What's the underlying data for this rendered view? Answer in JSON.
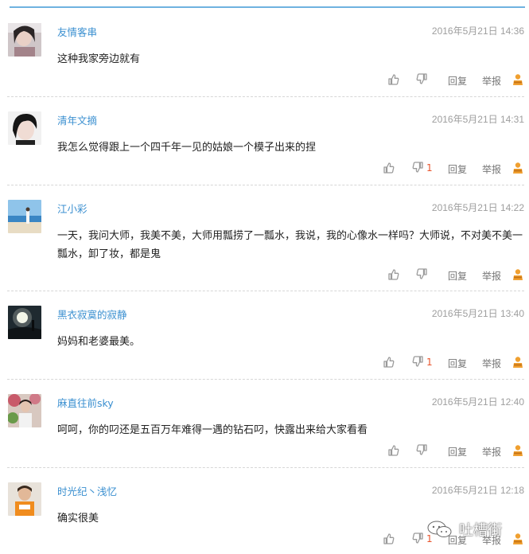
{
  "comments": [
    {
      "username": "友情客串",
      "timestamp": "2016年5月21日 14:36",
      "text": "这种我家旁边就有",
      "reply": "回复",
      "report": "举报",
      "dislikes": ""
    },
    {
      "username": "清年文摘",
      "timestamp": "2016年5月21日 14:31",
      "text": "我怎么觉得跟上一个四千年一见的姑娘一个模子出来的捏",
      "reply": "回复",
      "report": "举报",
      "dislikes": "1"
    },
    {
      "username": "江小彩",
      "timestamp": "2016年5月21日 14:22",
      "text": "一天，我问大师，我美不美，大师用瓢捞了一瓢水，我说，我的心像水一样吗？大师说，不对美不美一瓢水，卸了妆，都是鬼",
      "reply": "回复",
      "report": "举报",
      "dislikes": ""
    },
    {
      "username": "黑衣寂寞的寂静",
      "timestamp": "2016年5月21日 13:40",
      "text": "妈妈和老婆最美。",
      "reply": "回复",
      "report": "举报",
      "dislikes": "1"
    },
    {
      "username": "麻直往前sky",
      "timestamp": "2016年5月21日 12:40",
      "text": "呵呵，你的叼还是五百万年难得一遇的钻石叼，快露出来给大家看看",
      "reply": "回复",
      "report": "举报",
      "dislikes": ""
    },
    {
      "username": "时光纪丶浅忆",
      "timestamp": "2016年5月21日 12:18",
      "text": "确实很美",
      "reply": "回复",
      "report": "举报",
      "dislikes": "1"
    }
  ],
  "watermark": {
    "text": "吐槽街",
    "icon": "wechat-icon"
  },
  "colors": {
    "username": "#3a8fd0",
    "timestamp": "#9e9e9e",
    "accent_line": "#6fb2e0",
    "dislike_count": "#e8542c",
    "badge": "#f0a030"
  }
}
